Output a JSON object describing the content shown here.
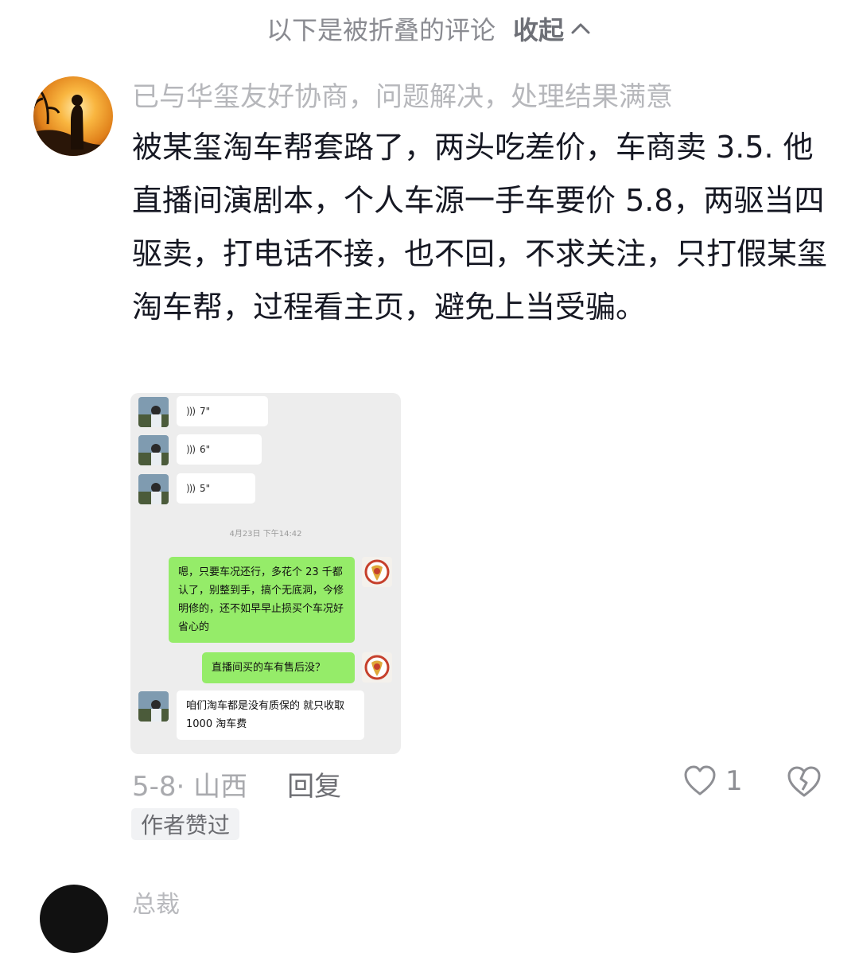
{
  "fold_bar": {
    "text": "以下是被折叠的评论",
    "toggle_label": "收起"
  },
  "comment": {
    "nickname": "已与华玺友好协商，问题解决，处理结果满意",
    "content": "被某玺淘车帮套路了，两头吃差价，车商卖 3.5. 他直播间演剧本，个人车源一手车要价 5.8，两驱当四驱卖，打电话不接，也不回，不求关注，只打假某玺淘车帮，过程看主页，避免上当受骗。",
    "chat_screenshot": {
      "voice_messages": [
        {
          "duration": "7\""
        },
        {
          "duration": "6\""
        },
        {
          "duration": "5\""
        }
      ],
      "timestamp": "4月23日 下午14:42",
      "messages": [
        {
          "side": "right",
          "text": "嗯，只要车况还行，多花个 23 千都认了，别整到手，搞个无底洞，今修明修的，还不如早早止损买个车况好省心的"
        },
        {
          "side": "right",
          "text": "直播间买的车有售后没？"
        },
        {
          "side": "left",
          "text": "咱们淘车都是没有质保的 就只收取1000 淘车费"
        }
      ]
    },
    "meta": {
      "date_location": "5-8· 山西",
      "reply_label": "回复",
      "like_count": "1"
    },
    "author_liked": "作者赞过"
  },
  "next_comment": {
    "nickname_partial": "总裁"
  },
  "icons": {
    "fold_toggle": "chevron-up-icon",
    "like": "heart-outline-icon",
    "dislike": "broken-heart-icon"
  },
  "colors": {
    "green_bubble": "#95ec69",
    "chat_background": "#ededed",
    "text_primary": "#161823",
    "text_muted": "#a9aaae"
  }
}
